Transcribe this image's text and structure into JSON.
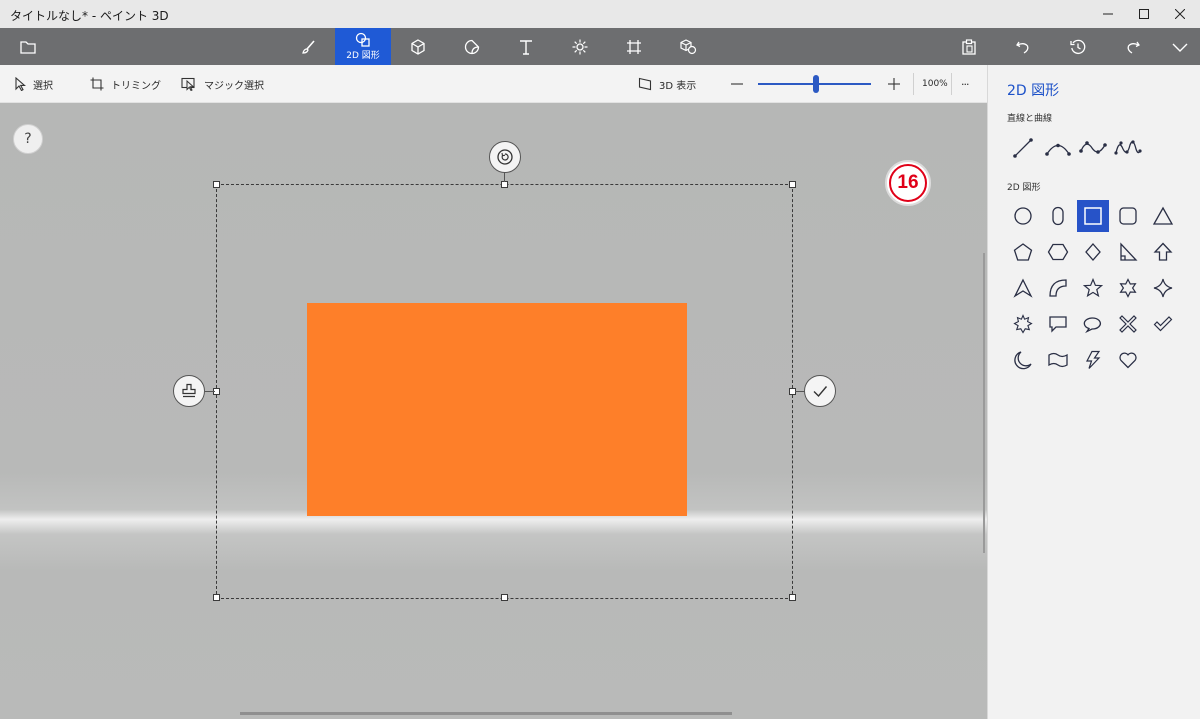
{
  "window": {
    "title": "タイトルなし* - ペイント 3D",
    "controls": [
      "minimize-icon",
      "maximize-icon",
      "close-icon"
    ]
  },
  "toolbar": {
    "left": [
      "folder-icon"
    ],
    "tools": [
      "brush-icon",
      "2d-shapes-icon",
      "3d-shapes-icon",
      "stickers-icon",
      "text-icon",
      "effects-icon",
      "canvas-icon",
      "3d-library-icon"
    ],
    "active_tool_label": "2D 図形",
    "right": [
      "paste-icon",
      "undo-icon",
      "history-icon",
      "redo-icon",
      "expand-icon"
    ]
  },
  "subbar": {
    "select_label": "選択",
    "crop_label": "トリミング",
    "magic_select_label": "マジック選択",
    "view3d_label": "3D 表示",
    "zoom_label": "100%",
    "zoom_value": 0.5,
    "more_label": "···"
  },
  "canvas": {
    "help_label": "?",
    "step_badge": "16",
    "shape_fill": "#fe7f29",
    "selection_controls": [
      "rotate-icon",
      "stamp-icon",
      "confirm-icon"
    ]
  },
  "panel": {
    "title": "2D 図形",
    "lines_heading": "直線と曲線",
    "shapes_heading": "2D 図形",
    "lines": [
      "line",
      "curve-2pt",
      "curve-3pt",
      "curve-4pt"
    ],
    "shapes": [
      "circle",
      "capsule",
      "square",
      "rounded-square",
      "triangle",
      "pentagon",
      "hexagon",
      "diamond",
      "right-triangle",
      "arrow-up",
      "arrowhead",
      "quarter-circle",
      "star-5",
      "star-6",
      "star-4",
      "burst",
      "speech-rect",
      "speech-oval",
      "x-mark",
      "check-mark",
      "crescent",
      "wave-banner",
      "lightning",
      "heart"
    ],
    "selected_shape": "square"
  },
  "colors": {
    "accent": "#1f5ad6",
    "toolbar_bg": "#6d6e70",
    "shape_fill": "#fe7f29",
    "badge": "#e00018"
  }
}
